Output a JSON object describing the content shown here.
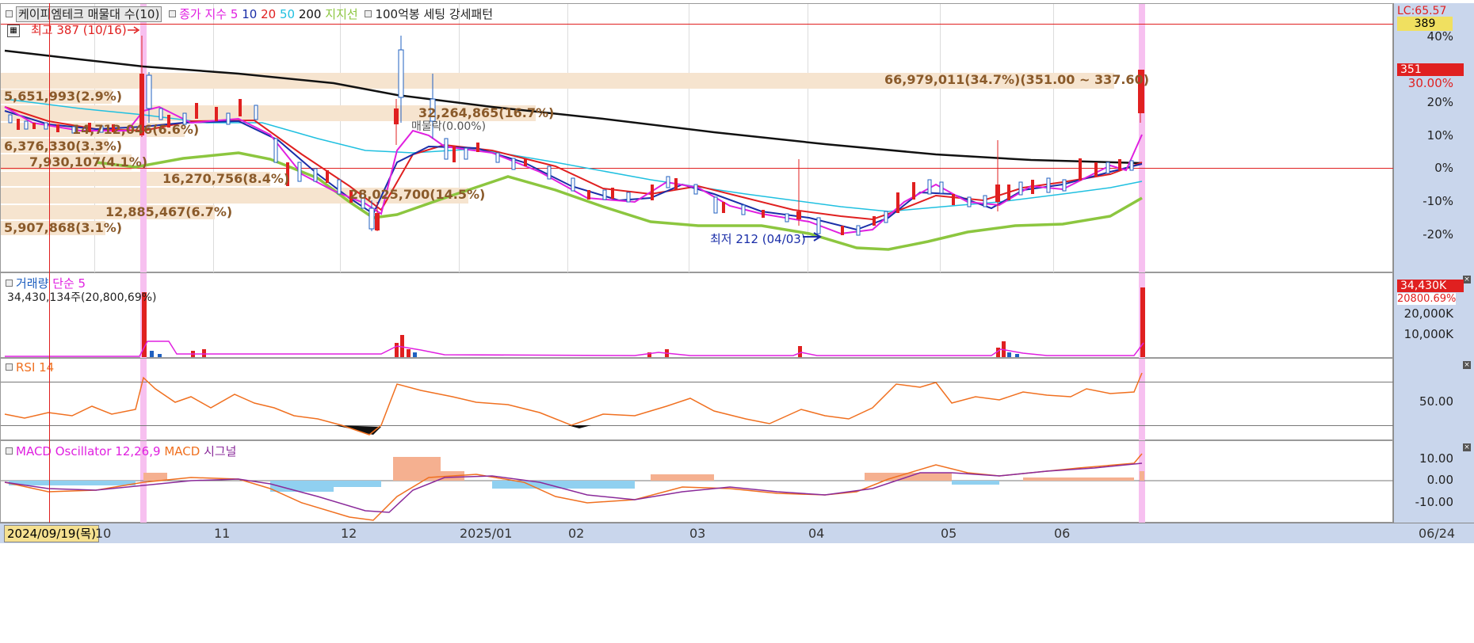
{
  "legend": {
    "stock_name": "케이피엠테크 매물대 수(10)",
    "close_label": "종가",
    "ema_label": "지수",
    "ma5": "5",
    "ma10": "10",
    "ma20": "20",
    "ma50": "50",
    "ma200": "200",
    "support": "지지선",
    "pattern": "100억봉 세팅 강세패턴"
  },
  "price_pane": {
    "high_marker": "최고 387 (10/16)",
    "low_marker": "최저 212 (04/03)",
    "annotation_top": "66,979,011(34.7%)(351.00 ~ 337.60)",
    "annotation_mid": "32,264,865(16.7%)",
    "annotation_trade": "매물락(0.00%)",
    "volume_profile": [
      "5,651,993(2.9%)",
      "14,712,046(6.6%)",
      "6,376,330(3.3%)",
      "7,930,107(4.1%)",
      "16,270,756(8.4%)",
      "28,025,700(14.5%)",
      "12,885,467(6.7%)",
      "5,907,868(3.1%)"
    ],
    "right_axis": {
      "top_label": "LC:65.57",
      "current_box": "389",
      "price_box": "351",
      "ticks": [
        "40%",
        "30.00%",
        "20%",
        "10%",
        "0%",
        "-10%",
        "-20%"
      ]
    }
  },
  "volume_pane": {
    "title_volume": "거래량",
    "title_ma": "단순 5",
    "info": "34,430,134주(20,800,69%)",
    "right_axis": {
      "current_box": "34,430K",
      "sub_box": "20800.69%",
      "ticks": [
        "20,000K",
        "10,000K"
      ]
    }
  },
  "rsi_pane": {
    "title": "RSI 14",
    "right_axis": {
      "ticks": [
        "50.00"
      ]
    }
  },
  "macd_pane": {
    "title_osc": "MACD Oscillator 12,26,9",
    "title_macd": "MACD",
    "title_signal": "시그널",
    "right_axis": {
      "ticks": [
        "10.00",
        "0.00",
        "-10.00"
      ]
    }
  },
  "x_axis": {
    "cursor_date": "2024/09/19(목)",
    "labels": [
      "10",
      "11",
      "12",
      "2025/01",
      "02",
      "03",
      "04",
      "05",
      "06"
    ],
    "right_label": "06/24"
  },
  "colors": {
    "up": "#e02020",
    "down": "#2060c0",
    "ma5": "#e020e0",
    "ma10": "#1a2ea8",
    "ma20": "#e02020",
    "ma50": "#20c0e0",
    "ma200": "#111111",
    "support": "#8cc63f",
    "rsi": "#f07020",
    "macd": "#f07020",
    "signal": "#8a2a9a",
    "osc_pos": "#f5b090",
    "osc_neg": "#90d0f0"
  }
}
